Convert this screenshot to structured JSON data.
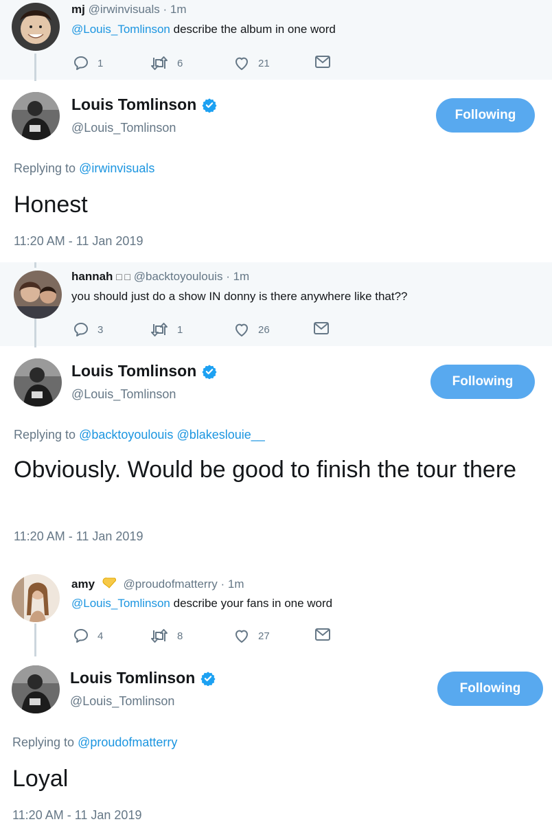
{
  "tweets": [
    {
      "parent": {
        "name": "mj",
        "handle": "@irwinvisuals",
        "dot": "·",
        "time": "1m",
        "mention": "@Louis_Tomlinson",
        "text": " describe the album in one word",
        "replies": "1",
        "retweets": "6",
        "likes": "21"
      },
      "reply": {
        "name": "Louis Tomlinson",
        "handle": "@Louis_Tomlinson",
        "follow_label": "Following",
        "replying_prefix": "Replying to ",
        "replying_to": "@irwinvisuals",
        "replying_to_2": "",
        "text": "Honest",
        "timestamp": "11:20 AM - 11 Jan 2019"
      }
    },
    {
      "parent": {
        "name": "hannah",
        "name_emoji": "□ □",
        "handle": "@backtoyoulouis",
        "dot": "·",
        "time": "1m",
        "mention": "",
        "text": "you should just do a show IN donny is there anywhere like that??",
        "replies": "3",
        "retweets": "1",
        "likes": "26"
      },
      "reply": {
        "name": "Louis Tomlinson",
        "handle": "@Louis_Tomlinson",
        "follow_label": "Following",
        "replying_prefix": "Replying to ",
        "replying_to": "@backtoyoulouis",
        "replying_to_2": "@blakeslouie__",
        "text": "Obviously. Would be good to finish the tour there",
        "timestamp": "11:20 AM - 11 Jan 2019"
      }
    },
    {
      "parent": {
        "name": "amy",
        "handle": "@proudofmatterry",
        "dot": "·",
        "time": "1m",
        "mention": "@Louis_Tomlinson",
        "text": " describe your fans in one word",
        "replies": "4",
        "retweets": "8",
        "likes": "27"
      },
      "reply": {
        "name": "Louis Tomlinson",
        "handle": "@Louis_Tomlinson",
        "follow_label": "Following",
        "replying_prefix": "Replying to ",
        "replying_to": "@proudofmatterry",
        "replying_to_2": "",
        "text": "Loyal",
        "timestamp": "11:20 AM - 11 Jan 2019"
      }
    }
  ],
  "icons": {
    "reply": "reply-icon",
    "retweet": "retweet-icon",
    "like": "heart-icon",
    "dm": "envelope-icon",
    "verified": "verified-badge-icon",
    "yellow_heart": "yellow-heart-emoji"
  },
  "colors": {
    "link": "#1b95e0",
    "follow_button": "#58a9ef",
    "muted": "#657786",
    "band": "#f5f8fa"
  }
}
